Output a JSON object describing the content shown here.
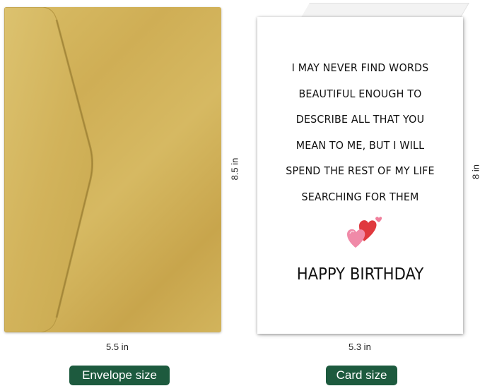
{
  "card": {
    "verse_lines": [
      "I MAY NEVER FIND WORDS",
      "BEAUTIFUL ENOUGH TO",
      "DESCRIBE ALL THAT YOU",
      "MEAN TO ME, BUT I WILL",
      "SPEND THE REST OF MY LIFE",
      "SEARCHING FOR THEM"
    ],
    "greeting": "HAPPY BIRTHDAY",
    "decoration_icon": "hearts-icon"
  },
  "dimensions": {
    "envelope_height": "8.5 in",
    "envelope_width": "5.5 in",
    "card_height": "8 in",
    "card_width": "5.3 in"
  },
  "labels": {
    "envelope": "Envelope size",
    "card": "Card size"
  },
  "colors": {
    "envelope_gold": "#d3b35c",
    "badge_green": "#1d5a3e",
    "heart_red": "#e0393e",
    "heart_pink": "#f08aa8"
  }
}
